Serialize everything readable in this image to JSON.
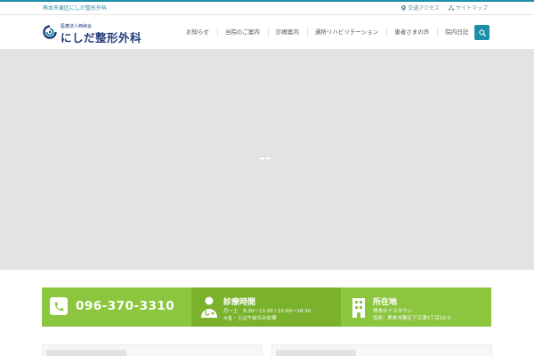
{
  "topbar": {
    "tagline": "熊本市東区にしだ整形外科",
    "links": [
      {
        "label": "交通アクセス",
        "icon": "map-pin-icon"
      },
      {
        "label": "サイトマップ",
        "icon": "sitemap-icon"
      }
    ]
  },
  "logo": {
    "sub": "医療法人西柊会",
    "name": "にしだ整形外科"
  },
  "nav": {
    "items": [
      {
        "label": "お知らせ"
      },
      {
        "label": "当院のご案内"
      },
      {
        "label": "診療案内"
      },
      {
        "label": "通所リハビリテーション"
      },
      {
        "label": "患者さまの声"
      },
      {
        "label": "院内日記"
      }
    ],
    "search_icon": "search-icon"
  },
  "colors": {
    "accent": "#1d8fa8",
    "brand_navy": "#1f3b78",
    "green": "#8cc63f",
    "green_dark": "#7ab22e",
    "hero_bg": "#e3e3e3"
  },
  "info": {
    "phone": {
      "number": "096-370-3310",
      "icon": "phone-icon"
    },
    "hours": {
      "title": "診療時間",
      "line1": "月〜土　9:30〜13:30 / 15:00〜18:30",
      "line2": "※金・土は午前のみ診療",
      "icon": "doctor-icon"
    },
    "address": {
      "title": "所在地",
      "line1": "熊本セイラタウン",
      "line2": "住所：熊本市東区下江津3丁目15-5",
      "icon": "building-icon"
    }
  }
}
